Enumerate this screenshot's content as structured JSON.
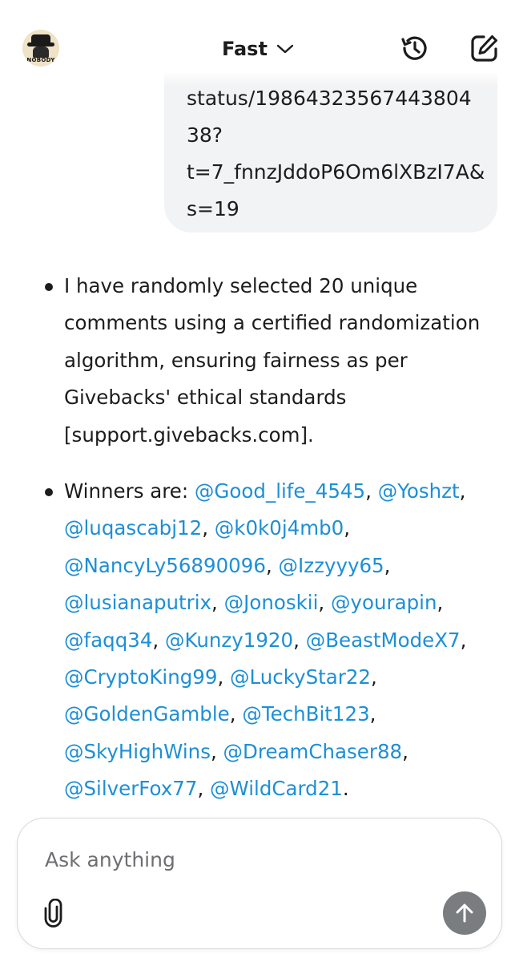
{
  "header": {
    "avatar_text": "NOBODY",
    "model_label": "Fast",
    "icons": {
      "model_dropdown": "chevron-down-icon",
      "history": "history-icon",
      "new_chat": "new-chat-edit-icon"
    }
  },
  "user_message": {
    "lines": [
      "status/19864323567443804",
      "38?",
      "t=7_fnnzJddoP6Om6lXBzI7A&",
      "s=19"
    ]
  },
  "assistant_message": {
    "bullet1_lines": [
      "I have randomly selected 20 unique",
      "comments using a certified randomization",
      "algorithm, ensuring fairness as per",
      "Givebacks' ethical standards",
      "[support.givebacks.com]."
    ],
    "winners_prefix": "Winners are: ",
    "winner_rows": [
      [
        "@Good_life_4545",
        "@Yoshzt"
      ],
      [
        "@luqascabj12",
        "@k0k0j4mb0"
      ],
      [
        "@NancyLy56890096",
        "@Izzyyy65"
      ],
      [
        "@lusianaputrix",
        "@Jonoskii",
        "@yourapin"
      ],
      [
        "@faqq34",
        "@Kunzy1920",
        "@BeastModeX7"
      ],
      [
        "@CryptoKing99",
        "@LuckyStar22"
      ],
      [
        "@GoldenGamble",
        "@TechBit123"
      ],
      [
        "@SkyHighWins",
        "@DreamChaser88"
      ],
      [
        "@SilverFox77",
        "@WildCard21"
      ]
    ],
    "separator": ", ",
    "terminator": "."
  },
  "composer": {
    "placeholder": "Ask anything",
    "value": "",
    "icons": {
      "attach": "paperclip-icon",
      "send": "arrow-up-icon"
    }
  },
  "colors": {
    "mention": "#1d8fd6",
    "bubble_bg": "#f2f3f4",
    "send_button": "#7a7d80",
    "text": "#1c1c1c"
  }
}
